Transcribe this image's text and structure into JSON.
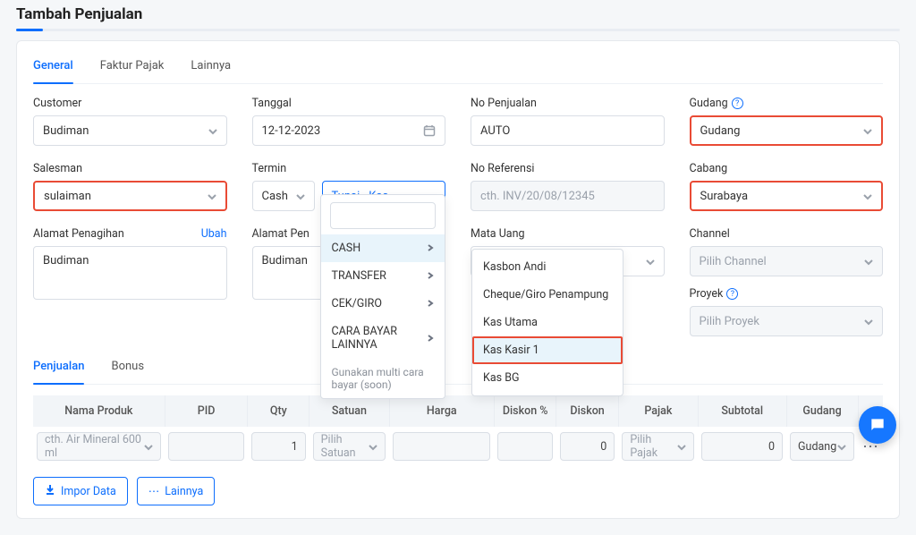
{
  "page_title": "Tambah Penjualan",
  "tabs": {
    "general": "General",
    "faktur": "Faktur Pajak",
    "lainnya": "Lainnya"
  },
  "labels": {
    "customer": "Customer",
    "tanggal": "Tanggal",
    "no_penjualan": "No Penjualan",
    "gudang": "Gudang",
    "salesman": "Salesman",
    "termin": "Termin",
    "no_referensi": "No Referensi",
    "cabang": "Cabang",
    "alamat_penagihan": "Alamat Penagihan",
    "ubah": "Ubah",
    "alamat_pengiriman": "Alamat Pen",
    "mata_uang": "Mata Uang",
    "channel": "Channel",
    "proyek": "Proyek"
  },
  "values": {
    "customer": "Budiman",
    "tanggal": "12-12-2023",
    "no_penjualan": "AUTO",
    "gudang": "Gudang",
    "salesman": "sulaiman",
    "termin_type": "Cash",
    "termin_cash": "Tunai - Kas ..",
    "no_referensi_ph": "cth. INV/20/08/12345",
    "cabang": "Surabaya",
    "alamat_penagihan": "Budiman",
    "alamat_pengiriman": "Budiman",
    "channel_ph": "Pilih Channel",
    "proyek_ph": "Pilih Proyek"
  },
  "pay_methods": {
    "items": [
      "CASH",
      "TRANSFER",
      "CEK/GIRO",
      "CARA BAYAR LAINNYA"
    ],
    "note": "Gunakan multi cara bayar (soon)",
    "cash_sub": [
      "Kasbon Andi",
      "Cheque/Giro Penampung",
      "Kas Utama",
      "Kas Kasir 1",
      "Kas BG"
    ]
  },
  "product_tabs": {
    "penjualan": "Penjualan",
    "bonus": "Bonus"
  },
  "table": {
    "headers": [
      "Nama Produk",
      "PID",
      "Qty",
      "Satuan",
      "Harga",
      "Diskon %",
      "Diskon",
      "Pajak",
      "Subtotal",
      "Gudang"
    ],
    "row": {
      "nama_ph": "cth. Air Mineral 600 ml",
      "qty": "1",
      "satuan_ph": "Pilih Satuan",
      "diskon": "0",
      "pajak_ph": "Pilih Pajak",
      "subtotal": "0",
      "gudang": "Gudang"
    }
  },
  "buttons": {
    "impor": "Impor Data",
    "lainnya": "Lainnya"
  }
}
